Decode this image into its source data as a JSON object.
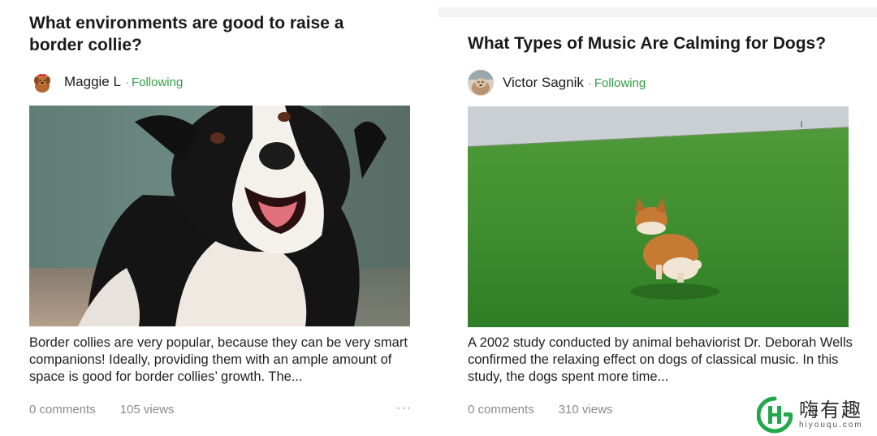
{
  "posts": [
    {
      "title": "What environments are good to raise a border collie?",
      "author": "Maggie  L",
      "separator": "·",
      "follow_status": "Following",
      "excerpt": "Border collies are very popular, because they can be very smart companions! Ideally, providing them with an ample amount of space is good for border collies’ growth. The...",
      "comments": "0 comments",
      "views": "105 views",
      "more": "···"
    },
    {
      "title": "What Types of Music Are Calming for Dogs?",
      "author": "Victor Sagnik",
      "separator": "·",
      "follow_status": "Following",
      "excerpt": "A 2002 study conducted by animal behaviorist Dr. Deborah Wells confirmed the relaxing effect on dogs of classical music. In this study, the dogs spent more time...",
      "comments": "0 comments",
      "views": "310 views"
    }
  ],
  "watermark": {
    "name": "嗨有趣",
    "url": "hiyouqu.com"
  },
  "colors": {
    "follow": "#2f9e44",
    "meta": "#8a8a8a",
    "brand_green": "#22a84a"
  }
}
